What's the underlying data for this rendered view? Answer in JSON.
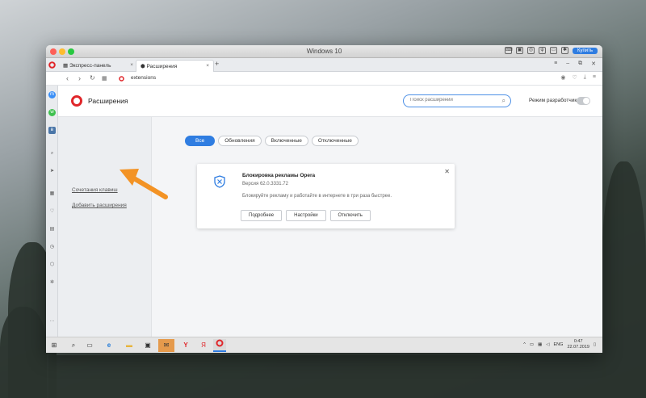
{
  "window": {
    "title": "Windows 10",
    "buy_label": "Купить"
  },
  "tabs": [
    {
      "label": "Экспресс-панель"
    },
    {
      "label": "Расширения"
    }
  ],
  "address": {
    "url": "extensions"
  },
  "page": {
    "title": "Расширения",
    "search_placeholder": "Поиск расширений",
    "dev_mode_label": "Режим разработчика",
    "left_links": [
      "Сочетания клавиш",
      "Добавить расширения"
    ],
    "filters": [
      "Все",
      "Обновления",
      "Включенные",
      "Отключенные"
    ],
    "active_filter": "Все"
  },
  "extension": {
    "name": "Блокировка рекламы Opera",
    "version": "Версия 62.0.3331.72",
    "description": "Блокируйте рекламу и работайте в интернете в три раза быстрее.",
    "buttons": [
      "Подробнее",
      "Настройки",
      "Отключить"
    ]
  },
  "taskbar": {
    "language": "ENG",
    "time": "0:47",
    "date": "22.07.2019"
  },
  "colors": {
    "accent": "#2f7de1",
    "opera_red": "#e0262a",
    "arrow": "#f39325"
  }
}
